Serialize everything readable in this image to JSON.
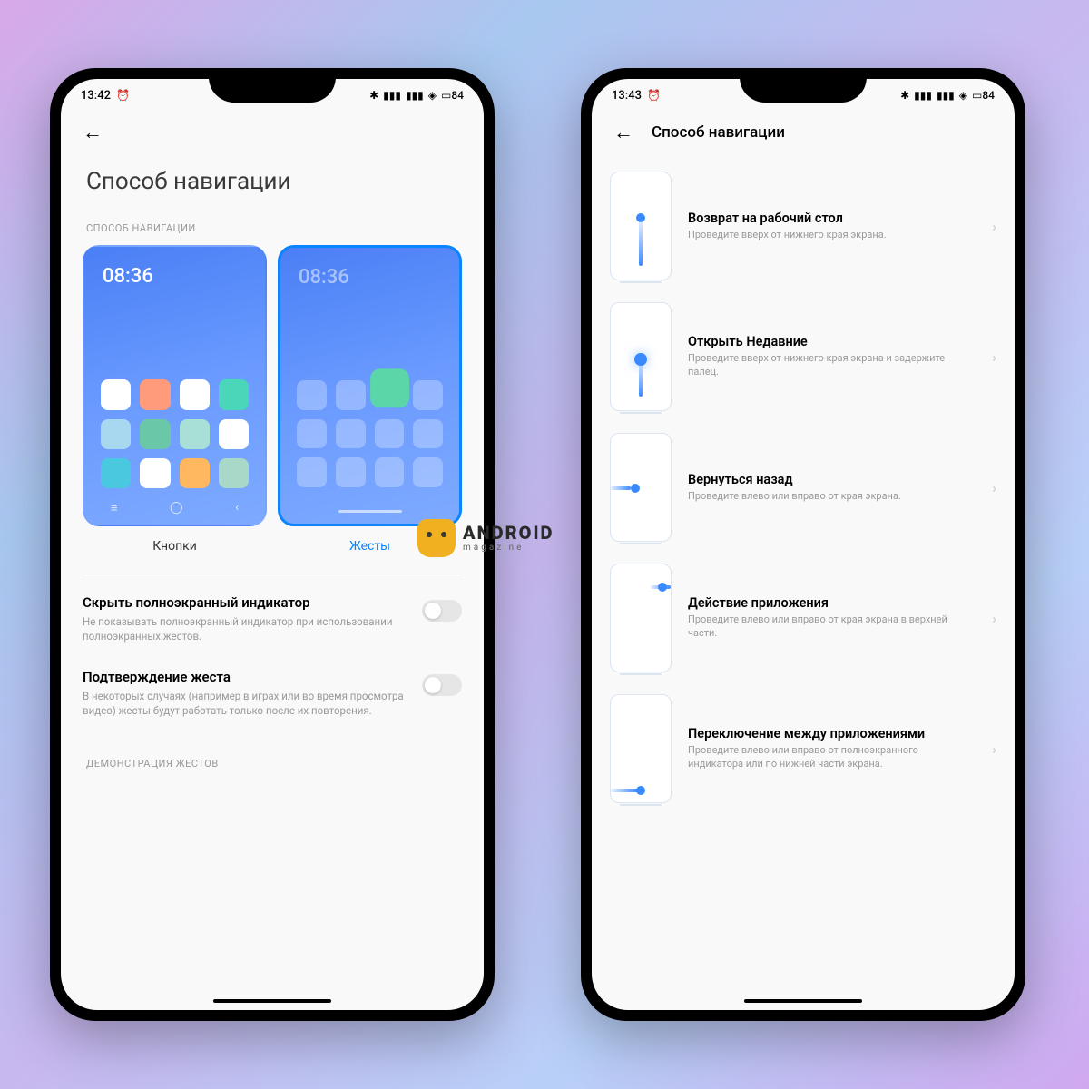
{
  "watermark": {
    "brand": "ANDROID",
    "sub": "magazine"
  },
  "phoneLeft": {
    "statusbar": {
      "time": "13:42",
      "battery": "84"
    },
    "pageTitle": "Способ навигации",
    "sectionCaption": "СПОСОБ НАВИГАЦИИ",
    "modes": {
      "buttons": {
        "label": "Кнопки",
        "time": "08:36"
      },
      "gestures": {
        "label": "Жесты",
        "time": "08:36"
      }
    },
    "settings": {
      "hideIndicator": {
        "title": "Скрыть полноэкранный индикатор",
        "desc": "Не показывать полноэкранный индикатор при использовании полноэкранных жестов."
      },
      "confirmGesture": {
        "title": "Подтверждение жеста",
        "desc": "В некоторых случаях (например в играх или во время просмотра видео) жесты будут работать только после их повторения."
      }
    },
    "demoCaption": "ДЕМОНСТРАЦИЯ ЖЕСТОВ"
  },
  "phoneRight": {
    "statusbar": {
      "time": "13:43",
      "battery": "84"
    },
    "headerTitle": "Способ навигации",
    "gestures": {
      "home": {
        "title": "Возврат на рабочий стол",
        "desc": "Проведите вверх от нижнего края экрана."
      },
      "recent": {
        "title": "Открыть Недавние",
        "desc": "Проведите вверх от нижнего края экрана и задержите палец."
      },
      "back": {
        "title": "Вернуться назад",
        "desc": "Проведите влево или вправо от края экрана."
      },
      "appAction": {
        "title": "Действие приложения",
        "desc": "Проведите влево или вправо от края экрана в верхней части."
      },
      "switch": {
        "title": "Переключение между приложениями",
        "desc": "Проведите влево или вправо от полноэкранного индикатора или по нижней части экрана."
      }
    }
  }
}
